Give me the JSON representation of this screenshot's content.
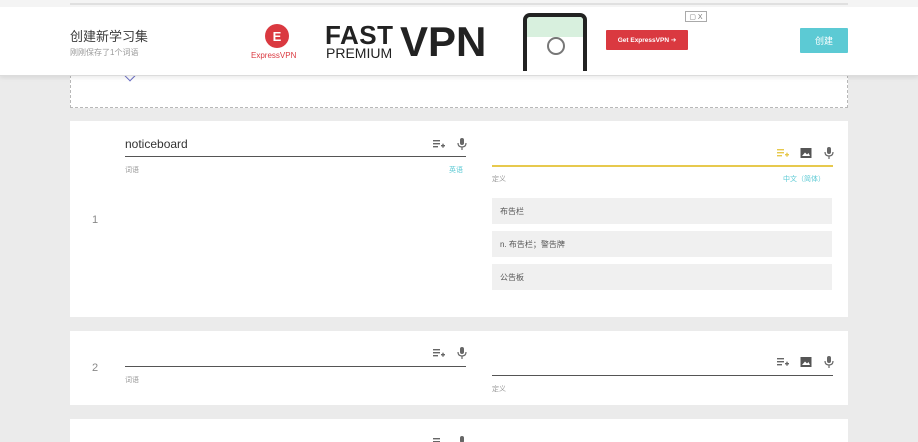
{
  "header": {
    "title": "创建新学习集",
    "subtitle": "刚刚保存了1个词语",
    "create_label": "创建"
  },
  "ad": {
    "close_label": "▢ X",
    "logo_letter": "E",
    "brand": "ExpressVPN",
    "headline_fast": "FAST",
    "headline_premium": "PREMIUM",
    "headline_vpn": "VPN",
    "cta": "Get ExpressVPN ➔",
    "brand_color": "#da3940"
  },
  "cards": [
    {
      "number": "1",
      "term": "noticeboard",
      "term_label": "词语",
      "term_lang": "英语",
      "def_label": "定义",
      "def_lang": "中文（简体）",
      "suggestions": [
        "布告栏",
        "n. 布告栏；警告牌",
        "公告板"
      ]
    },
    {
      "number": "2",
      "term": "",
      "term_label": "词语",
      "def_label": "定义"
    }
  ],
  "colors": {
    "accent": "#5ccad4",
    "active_underline": "#e7c94d"
  }
}
